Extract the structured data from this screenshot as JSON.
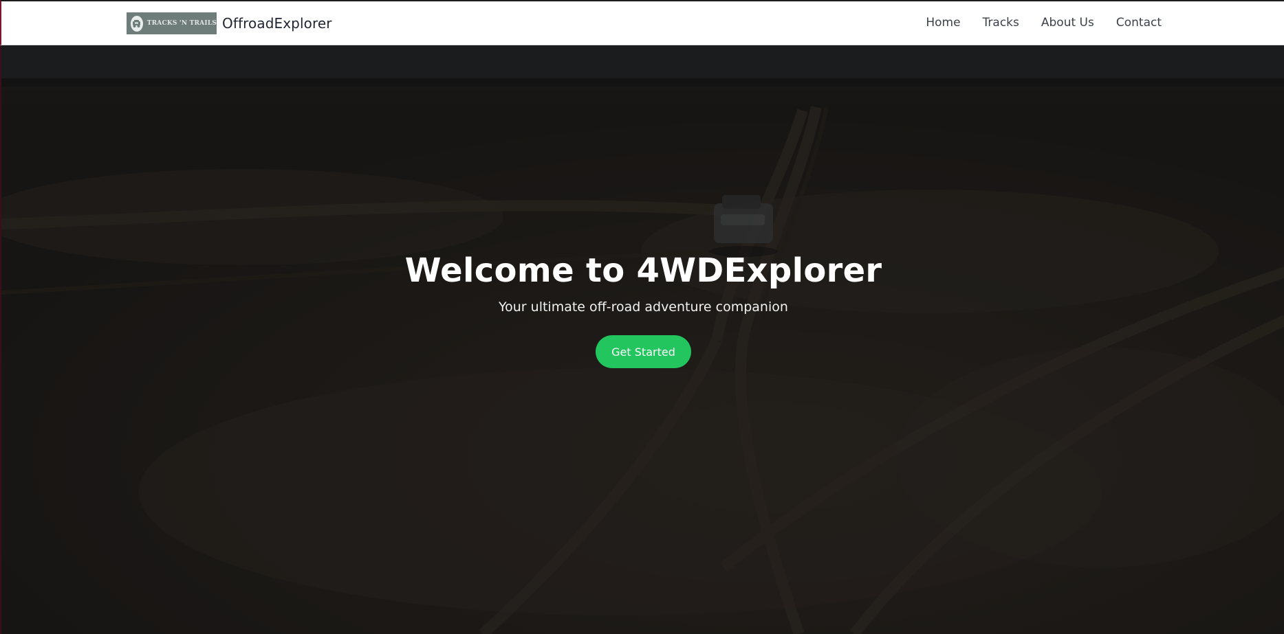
{
  "nav": {
    "logo_text": "TRACKS 'N TRAILS",
    "brand_name": "OffroadExplorer",
    "links": [
      {
        "label": "Home"
      },
      {
        "label": "Tracks"
      },
      {
        "label": "About Us"
      },
      {
        "label": "Contact"
      }
    ]
  },
  "hero": {
    "title": "Welcome to 4WDExplorer",
    "subtitle": "Your ultimate off-road adventure companion",
    "cta_label": "Get Started"
  },
  "colors": {
    "accent": "#22c55e",
    "nav_background": "#ffffff",
    "hero_overlay": "#1c1a16"
  },
  "icons": {
    "logo": "jeep-logo-icon"
  }
}
